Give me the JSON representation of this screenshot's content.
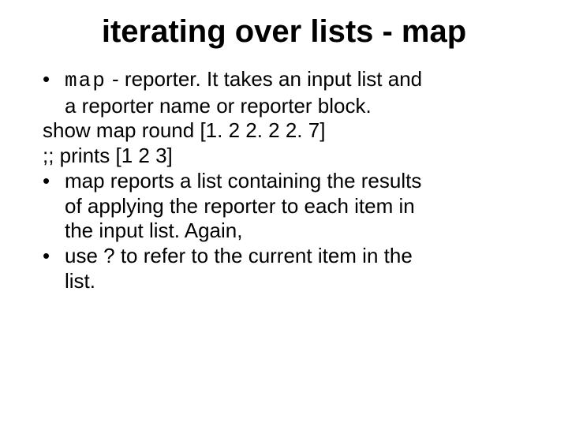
{
  "title": "iterating over lists - map",
  "b1_code": "map",
  "b1_rest": " - reporter. It takes an input list and",
  "b1_cont": "a reporter name or reporter block.",
  "code1": "show map round [1. 2 2. 2 2. 7]",
  "code2": ";; prints [1 2 3]",
  "b2": "map reports a list containing the results",
  "b2_cont1": "of applying the reporter to each item in",
  "b2_cont2": "the input list. Again,",
  "b3": "use ? to refer to the current item in the",
  "b3_cont": "list."
}
